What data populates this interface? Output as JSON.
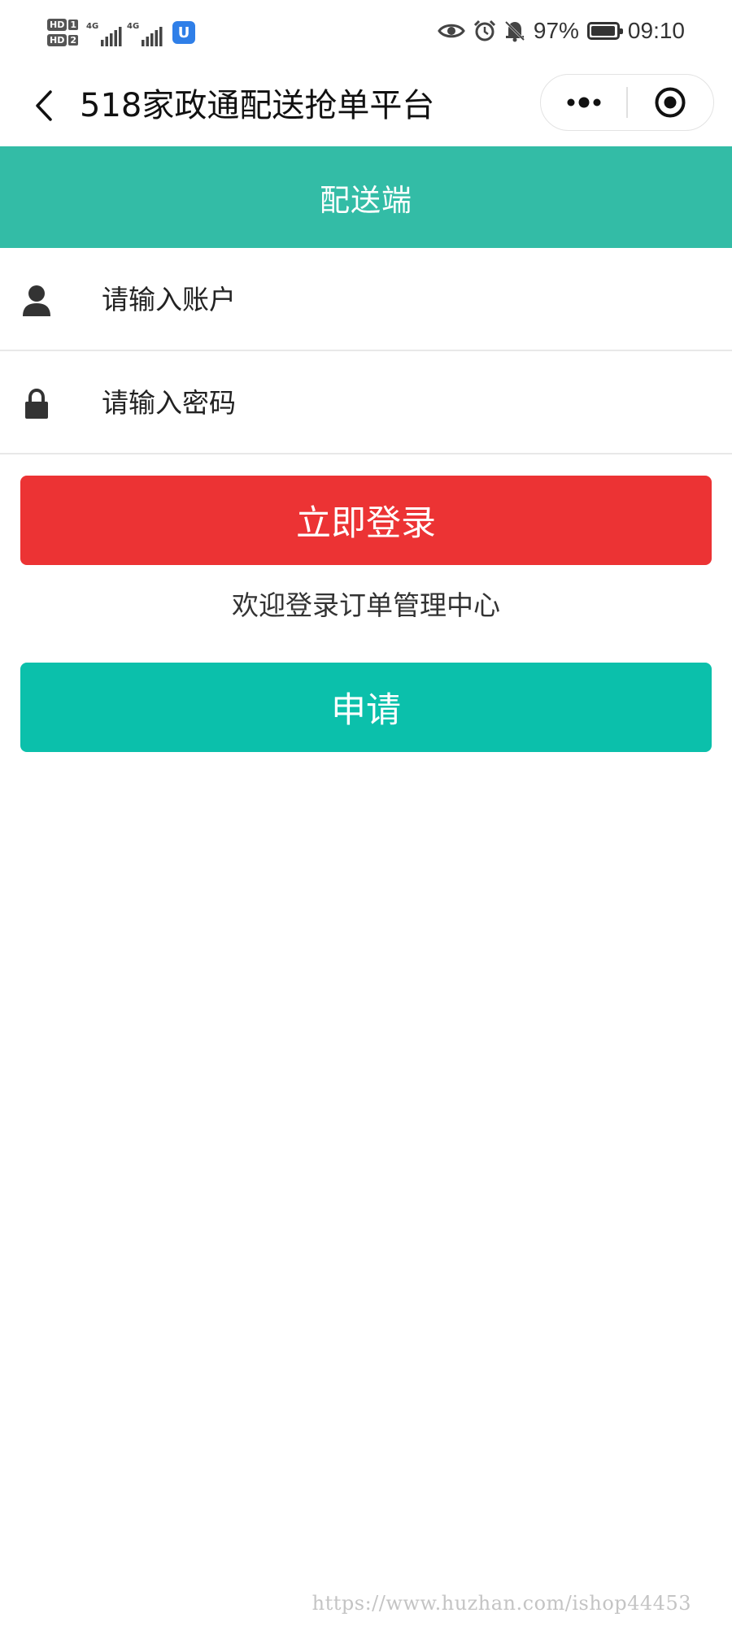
{
  "status_bar": {
    "sim1_badge": "HD",
    "sim1_num": "1",
    "sim2_badge": "HD",
    "sim2_num": "2",
    "sim1_network": "4G",
    "sim2_network": "4G",
    "app_badge_letter": "U",
    "battery_percent": "97%",
    "battery_level": 0.97,
    "time": "09:10"
  },
  "nav": {
    "title": "518家政通配送抢单平台",
    "back_icon": "chevron-left-icon",
    "more_icon": "more-dots-icon",
    "close_icon": "target-circle-icon"
  },
  "header": {
    "title": "配送端",
    "color": "#33bca6"
  },
  "form": {
    "account_placeholder": "请输入账户",
    "password_placeholder": "请输入密码",
    "account_icon": "user-icon",
    "password_icon": "lock-icon"
  },
  "actions": {
    "login_label": "立即登录",
    "login_color": "#ec3334",
    "welcome_text": "欢迎登录订单管理中心",
    "apply_label": "申请",
    "apply_color": "#0bc0ab"
  },
  "watermark": "https://www.huzhan.com/ishop44453"
}
